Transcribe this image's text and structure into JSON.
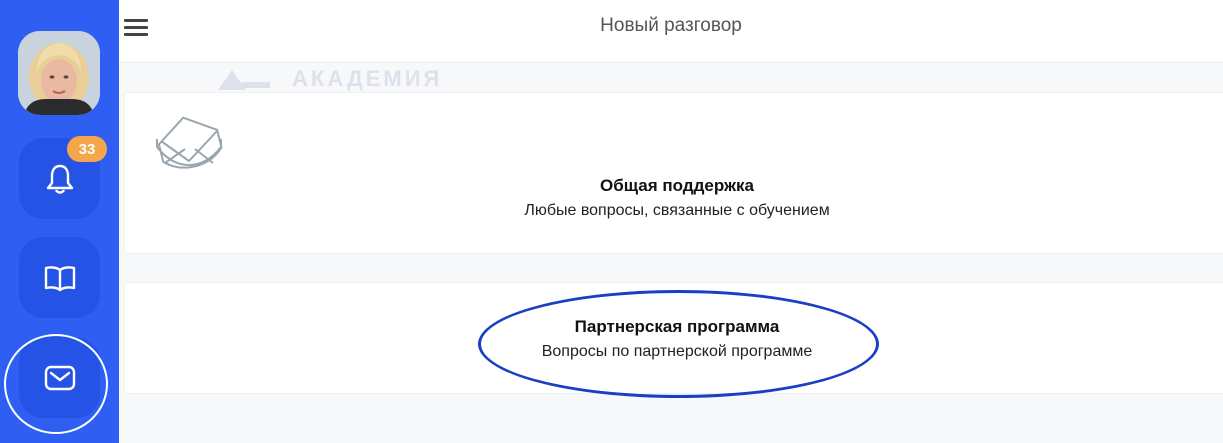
{
  "header": {
    "title": "Новый разговор",
    "menu_icon": "hamburger-menu-icon"
  },
  "sidebar": {
    "avatar_alt": "user-avatar",
    "items": [
      {
        "name": "notifications",
        "icon": "bell-icon",
        "badge": "33"
      },
      {
        "name": "courses",
        "icon": "book-icon"
      },
      {
        "name": "messages",
        "icon": "mail-icon",
        "active": true
      }
    ]
  },
  "watermark": {
    "text": "АКАДЕМИЯ"
  },
  "topics": [
    {
      "title": "Общая поддержка",
      "subtitle": "Любые вопросы, связанные с обучением",
      "icon": "envelope-icon"
    },
    {
      "title": "Партнерская программа",
      "subtitle": "Вопросы по партнерской программе"
    }
  ],
  "colors": {
    "sidebar_bg": "#2f5ff2",
    "sidebar_button_bg": "#2553e5",
    "badge_bg": "#f5a54a",
    "annotation_ellipse": "#1a3fc4",
    "page_bg": "#f7f8fa"
  }
}
